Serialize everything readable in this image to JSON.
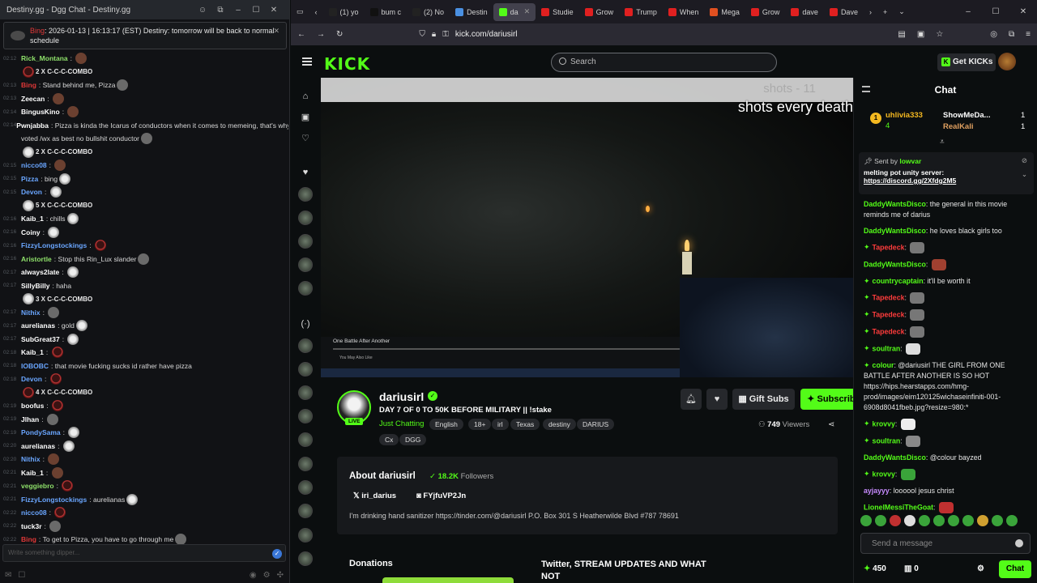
{
  "left": {
    "title": "Destiny.gg - Dgg Chat - Destiny.gg",
    "pinned": {
      "name": "Bing",
      "text": ": 2026-01-13 | 16:13:17 (EST) Destiny: tomorrow will be back to normal schedule"
    },
    "messages": [
      {
        "time": "02:12",
        "name": "Rick_Montana",
        "color": "#8ee06a",
        "text": "",
        "emotes": "br"
      },
      {
        "time": "",
        "name": "",
        "color": "#fff",
        "text": "",
        "combo": "2 X C-C-C-COMBO",
        "emotes": "r"
      },
      {
        "time": "02:13",
        "name": "Bing",
        "color": "#e03838",
        "text": "Stand behind me, Pizza",
        "emotes": "g"
      },
      {
        "time": "02:13",
        "name": "Zeecan",
        "color": "#ffffff",
        "text": "",
        "emotes": "br"
      },
      {
        "time": "02:14",
        "name": "BingusKino",
        "color": "#ffffff",
        "text": "",
        "emotes": "br"
      },
      {
        "time": "02:14",
        "name": "Pwnjabba",
        "color": "#ffffff",
        "text": "Pizza is kinda the Icarus of conductors when it comes to memeing, that's why I"
      },
      {
        "time": "",
        "name": "",
        "color": "#fff",
        "text": "voted /wx as best no bullshit conductor",
        "emotes": "g"
      },
      {
        "time": "",
        "name": "",
        "color": "#fff",
        "text": "",
        "combo": "2 X C-C-C-COMBO",
        "emotes": "w"
      },
      {
        "time": "02:15",
        "name": "nicco08",
        "color": "#6aa6ff",
        "text": "",
        "emotes": "br"
      },
      {
        "time": "02:15",
        "name": "Pizza",
        "color": "#6aa6ff",
        "text": "bing",
        "emotes": "w"
      },
      {
        "time": "02:15",
        "name": "Devon",
        "color": "#6aa6ff",
        "text": "",
        "emotes": "w"
      },
      {
        "time": "",
        "name": "",
        "color": "#fff",
        "text": "",
        "combo": "5 X C-C-C-COMBO",
        "emotes": "w"
      },
      {
        "time": "02:16",
        "name": "Kaib_1",
        "color": "#ffffff",
        "text": "chills",
        "emotes": "w"
      },
      {
        "time": "02:16",
        "name": "Coiny",
        "color": "#ffffff",
        "text": "",
        "emotes": "w"
      },
      {
        "time": "02:16",
        "name": "FizzyLongstockings",
        "color": "#6aa6ff",
        "text": "",
        "emotes": "r"
      },
      {
        "time": "02:16",
        "name": "Aristortle",
        "color": "#8ee06a",
        "text": "Stop this Rin_Lux slander",
        "emotes": "g"
      },
      {
        "time": "02:17",
        "name": "always2late",
        "color": "#ffffff",
        "text": "",
        "emotes": "w"
      },
      {
        "time": "02:17",
        "name": "SillyBilly",
        "color": "#ffffff",
        "text": "haha"
      },
      {
        "time": "",
        "name": "",
        "color": "#fff",
        "text": "",
        "combo": "3 X C-C-C-COMBO",
        "emotes": "w"
      },
      {
        "time": "02:17",
        "name": "Nithix",
        "color": "#6aa6ff",
        "text": "",
        "emotes": "g"
      },
      {
        "time": "02:17",
        "name": "aurelianas",
        "color": "#ffffff",
        "text": "gold",
        "emotes": "w"
      },
      {
        "time": "02:17",
        "name": "SubGreat37",
        "color": "#ffffff",
        "text": "",
        "emotes": "w"
      },
      {
        "time": "02:18",
        "name": "Kaib_1",
        "color": "#ffffff",
        "text": "",
        "emotes": "r"
      },
      {
        "time": "02:18",
        "name": "IOBOBC",
        "color": "#6aa6ff",
        "text": "that movie fucking sucks id rather have pizza"
      },
      {
        "time": "02:18",
        "name": "Devon",
        "color": "#6aa6ff",
        "text": "",
        "emotes": "r"
      },
      {
        "time": "",
        "name": "",
        "color": "#fff",
        "text": "",
        "combo": "4 X C-C-C-COMBO",
        "emotes": "r"
      },
      {
        "time": "02:19",
        "name": "boofus",
        "color": "#ffffff",
        "text": "",
        "emotes": "r"
      },
      {
        "time": "02:19",
        "name": "Jlhan",
        "color": "#ffffff",
        "text": "",
        "emotes": "g"
      },
      {
        "time": "02:19",
        "name": "PondySama",
        "color": "#6aa6ff",
        "text": "",
        "emotes": "w"
      },
      {
        "time": "02:20",
        "name": "aurelianas",
        "color": "#ffffff",
        "text": "",
        "emotes": "w"
      },
      {
        "time": "02:20",
        "name": "Nithix",
        "color": "#6aa6ff",
        "text": "",
        "emotes": "br"
      },
      {
        "time": "02:21",
        "name": "Kaib_1",
        "color": "#ffffff",
        "text": "",
        "emotes": "br"
      },
      {
        "time": "02:21",
        "name": "veggiebro",
        "color": "#8ee06a",
        "text": "",
        "emotes": "r"
      },
      {
        "time": "02:21",
        "name": "FizzyLongstockings",
        "color": "#6aa6ff",
        "text": "aurelianas",
        "emotes": "w"
      },
      {
        "time": "02:22",
        "name": "nicco08",
        "color": "#6aa6ff",
        "text": "",
        "emotes": "r"
      },
      {
        "time": "02:22",
        "name": "tuck3r",
        "color": "#ffffff",
        "text": "",
        "emotes": "g"
      },
      {
        "time": "02:22",
        "name": "Bing",
        "color": "#e03838",
        "text": "To get to Pizza, you have to go through me",
        "emotes": "g"
      }
    ],
    "input_placeholder": "Write something dipper..."
  },
  "browser": {
    "tabs": [
      {
        "label": "(1) yo",
        "color": "#222"
      },
      {
        "label": "bum c",
        "color": "#111"
      },
      {
        "label": "(2) No",
        "color": "#222"
      },
      {
        "label": "Destin",
        "color": "#4a90e2"
      },
      {
        "label": "da",
        "color": "#53fc18",
        "active": true
      },
      {
        "label": "Studie",
        "color": "#e02020"
      },
      {
        "label": "Grow",
        "color": "#e02020"
      },
      {
        "label": "Trump",
        "color": "#e02020"
      },
      {
        "label": "When",
        "color": "#e02020"
      },
      {
        "label": "Mega",
        "color": "#e05020"
      },
      {
        "label": "Grow",
        "color": "#e02020"
      },
      {
        "label": "dave",
        "color": "#e02020"
      },
      {
        "label": "Dave",
        "color": "#e02020"
      }
    ],
    "url": "kick.com/dariusirl"
  },
  "kick": {
    "logo": "KICK",
    "search_placeholder": "Search",
    "get_kicks": "Get KICKs"
  },
  "video": {
    "overlay_text": "shots every death",
    "overlay_text_dim": "shots - 11",
    "movie_title": "One Battle After Another",
    "may_like": "You May Also Like"
  },
  "channel": {
    "name": "dariusirl",
    "live": "LIVE",
    "stream_title": "DAY 7 OF 0 TO 50K BEFORE MILITARY || !stake",
    "category": "Just Chatting",
    "tags": [
      "English",
      "18+",
      "irl",
      "Texas",
      "destiny",
      "DARIUS",
      "Cx",
      "DGG"
    ],
    "gift_subs": "Gift Subs",
    "subscribe": "Subscribe",
    "viewers_count": "749",
    "viewers_label": "Viewers",
    "about_title": "About dariusirl",
    "followers_count": "18.2K",
    "followers_label": "Followers",
    "social_x": "iri_darius",
    "social_discord": "FYjfuVP2Jn",
    "bio": "I'm drinking hand sanitizer https://tinder.com/@dariusirl P.O. Box 301 S Heatherwilde Blvd #787 78691",
    "donations": "Donations",
    "twitter_panel": "Twitter, STREAM UPDATES AND WHAT NOT"
  },
  "chat": {
    "title": "Chat",
    "leaderboard": [
      {
        "rank": "1",
        "name": "uhlivia333",
        "count": "4"
      },
      {
        "name": "ShowMeDa...",
        "count": "1"
      },
      {
        "name": "RealKali",
        "count": "1"
      }
    ],
    "pinned": {
      "sent_by": "Sent by",
      "sender": "lowvar",
      "text": "melting pot unity server:",
      "link": "https://discord.gg/2Xfdg2M5"
    },
    "messages": [
      {
        "name": "DaddyWantsDisco",
        "color": "#53fc18",
        "text": "the general in this movie reminds me of darius"
      },
      {
        "name": "DaddyWantsDisco",
        "color": "#53fc18",
        "text": "he loves black girls too"
      },
      {
        "name": "Tapedeck",
        "color": "#ff3c3c",
        "badge": true,
        "text": "",
        "emote": "#777"
      },
      {
        "name": "DaddyWantsDisco",
        "color": "#53fc18",
        "text": "",
        "emote": "#a04030"
      },
      {
        "name": "countrycaptain",
        "color": "#53fc18",
        "badge": true,
        "text": "it'll be worth it"
      },
      {
        "name": "Tapedeck",
        "color": "#ff3c3c",
        "badge": true,
        "text": "",
        "emote": "#777"
      },
      {
        "name": "Tapedeck",
        "color": "#ff3c3c",
        "badge": true,
        "text": "",
        "emote": "#777"
      },
      {
        "name": "Tapedeck",
        "color": "#ff3c3c",
        "badge": true,
        "text": "",
        "emote": "#777"
      },
      {
        "name": "soultran",
        "color": "#53fc18",
        "badge": true,
        "text": "",
        "emote": "#ddd"
      },
      {
        "name": "colour",
        "color": "#53fc18",
        "badge": true,
        "text": "@dariusirl THE GIRL FROM ONE BATTLE AFTER ANOTHER IS SO HOT https://hips.hearstapps.com/hmg-prod/images/eim120125wichaseinfiniti-001-6908d8041fbeb.jpg?resize=980:*"
      },
      {
        "name": "krovvy",
        "color": "#53fc18",
        "badge": true,
        "text": "",
        "emote": "#eee"
      },
      {
        "name": "soultran",
        "color": "#53fc18",
        "badge": true,
        "text": "",
        "emote": "#888"
      },
      {
        "name": "DaddyWantsDisco",
        "color": "#53fc18",
        "text": "@colour bayzed"
      },
      {
        "name": "krovvy",
        "color": "#53fc18",
        "badge": true,
        "text": "",
        "emote": "#3aa43a"
      },
      {
        "name": "ayjayyy",
        "color": "#c78bff",
        "text": "loooool jesus christ"
      },
      {
        "name": "LionelMessiTheGoat",
        "color": "#53fc18",
        "text": "",
        "emote": "#c03030"
      }
    ],
    "input_placeholder": "Send a message",
    "kicks_count": "450",
    "gift_count": "0",
    "chat_button": "Chat"
  }
}
